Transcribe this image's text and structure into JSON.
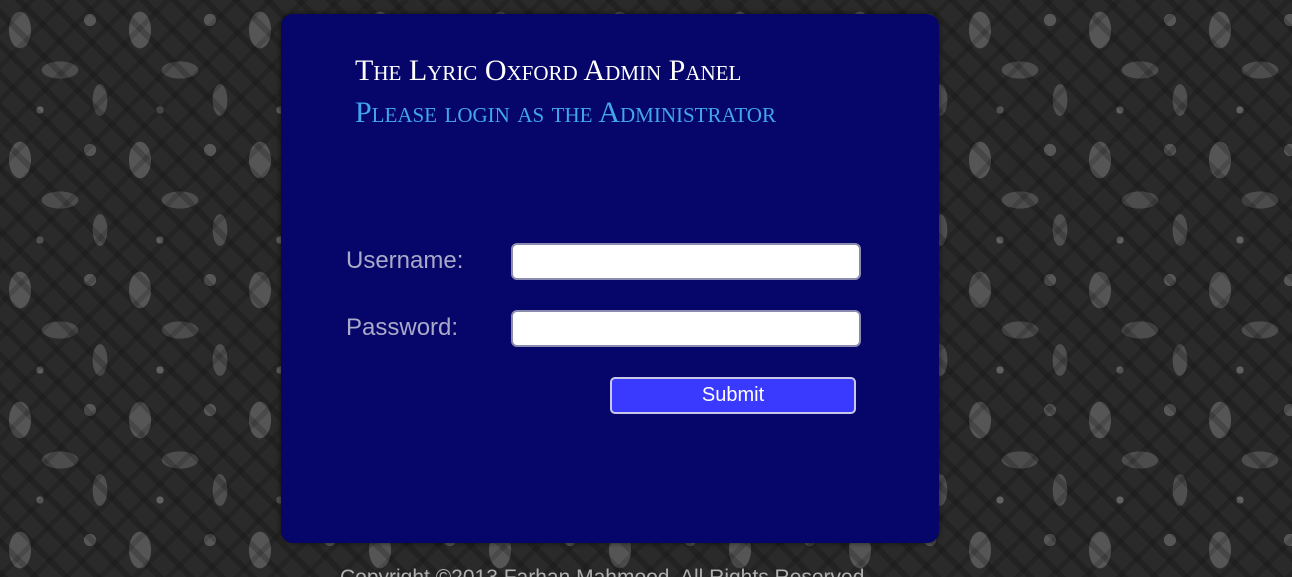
{
  "panel": {
    "title": "The Lyric Oxford Admin Panel",
    "subtitle": "Please login as the Administrator"
  },
  "form": {
    "username_label": "Username:",
    "username_value": "",
    "password_label": "Password:",
    "password_value": "",
    "submit_label": "Submit"
  },
  "footer": {
    "text": "Copyright ©2013 Farhan Mahmood. All Rights Reserved"
  },
  "colors": {
    "panel_background": "#05056a",
    "title": "#ffffff",
    "subtitle": "#41a6ee",
    "label": "#a9a9c9",
    "submit_button": "#3a3aff"
  }
}
